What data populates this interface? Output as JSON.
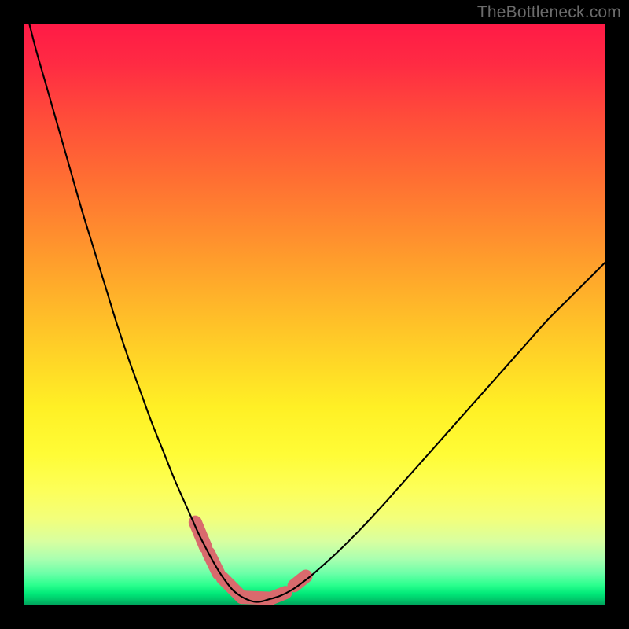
{
  "watermark": "TheBottleneck.com",
  "colors": {
    "frame": "#000000",
    "curve_stroke": "#000000",
    "marker_fill": "#d96a6d",
    "marker_stroke": "#c15457"
  },
  "chart_data": {
    "type": "line",
    "title": "",
    "xlabel": "",
    "ylabel": "",
    "xlim": [
      0,
      100
    ],
    "ylim": [
      0,
      100
    ],
    "grid": false,
    "x": [
      0,
      2,
      4,
      6,
      8,
      10,
      12,
      14,
      16,
      18,
      20,
      22,
      24,
      26,
      28,
      30,
      31,
      32,
      33,
      34,
      35,
      36,
      37,
      38,
      39,
      40,
      41,
      42,
      44,
      46,
      48,
      50,
      54,
      58,
      62,
      66,
      70,
      74,
      78,
      82,
      86,
      90,
      94,
      98,
      100
    ],
    "values": [
      104,
      96,
      89,
      82,
      75,
      68,
      61.5,
      55,
      48.5,
      42.5,
      37,
      31.5,
      26.5,
      21.5,
      17,
      12.5,
      10.5,
      8.6,
      6.8,
      5.2,
      3.8,
      2.6,
      1.8,
      1.2,
      0.8,
      0.6,
      0.7,
      1,
      1.6,
      2.6,
      4,
      5.6,
      9.2,
      13.2,
      17.5,
      22,
      26.5,
      31,
      35.5,
      40,
      44.5,
      49,
      53,
      57,
      59
    ],
    "annotations": [
      "Single-series curve depicting bottleneck percentage as a function of a component parameter (x). The curve descends steeply from the upper-left, reaches a near-zero minimum around x≈40, and rises more gradually toward the right."
    ],
    "markers": [
      {
        "x0": 29.5,
        "y0": 14.3,
        "x1": 31.3,
        "y1": 10.0
      },
      {
        "x0": 31.8,
        "y0": 9.0,
        "x1": 33.5,
        "y1": 5.5
      },
      {
        "x0": 34.2,
        "y0": 4.7,
        "x1": 37.5,
        "y1": 1.4
      },
      {
        "x0": 37.5,
        "y0": 1.4,
        "x1": 42.5,
        "y1": 1.2
      },
      {
        "x0": 42.5,
        "y0": 1.2,
        "x1": 45.0,
        "y1": 2.2
      },
      {
        "x0": 46.5,
        "y0": 3.4,
        "x1": 48.5,
        "y1": 5.0
      }
    ]
  }
}
